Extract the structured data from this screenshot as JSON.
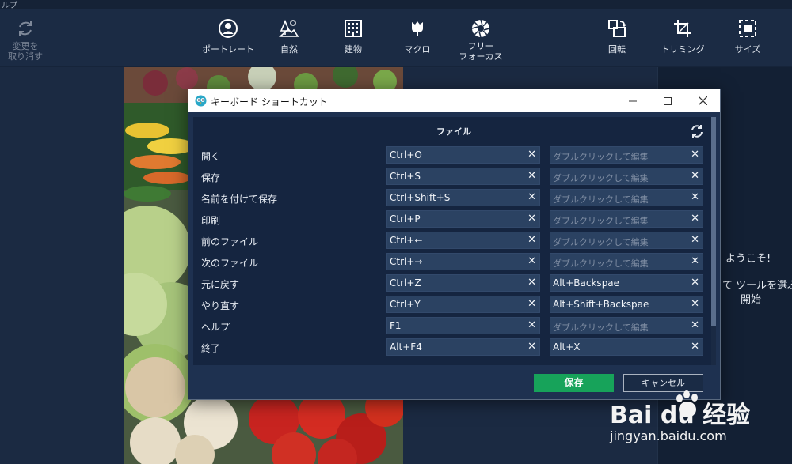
{
  "menu": {
    "partial_label": "ルプ"
  },
  "toolbar": {
    "undo": {
      "label_line1": "変更を",
      "label_line2": "取り消す",
      "icon": "undo-icon"
    },
    "tools": [
      {
        "id": "portrait",
        "label": "ポートレート",
        "icon": "portrait-icon"
      },
      {
        "id": "nature",
        "label": "自然",
        "icon": "nature-icon"
      },
      {
        "id": "building",
        "label": "建物",
        "icon": "building-icon"
      },
      {
        "id": "macro",
        "label": "マクロ",
        "icon": "tulip-icon"
      },
      {
        "id": "free-focus",
        "label_line1": "フリー",
        "label_line2": "フォーカス",
        "icon": "aperture-icon"
      },
      {
        "id": "rotate",
        "label": "回転",
        "icon": "rotate-icon"
      },
      {
        "id": "trimming",
        "label": "トリミング",
        "icon": "crop-icon"
      },
      {
        "id": "size",
        "label": "サイズ",
        "icon": "resize-icon"
      }
    ]
  },
  "right_panel": {
    "welcome": "ようこそ!",
    "hint_line1": "て ツールを選ぶ",
    "hint_line2": "開始"
  },
  "dialog": {
    "title": "キーボード ショートカット",
    "section": "ファイル",
    "placeholder": "ダブルクリックして編集",
    "rows": [
      {
        "label": "開く",
        "primary": "Ctrl+O",
        "secondary": ""
      },
      {
        "label": "保存",
        "primary": "Ctrl+S",
        "secondary": ""
      },
      {
        "label": "名前を付けて保存",
        "primary": "Ctrl+Shift+S",
        "secondary": ""
      },
      {
        "label": "印刷",
        "primary": "Ctrl+P",
        "secondary": ""
      },
      {
        "label": "前のファイル",
        "primary": "Ctrl+←",
        "secondary": ""
      },
      {
        "label": "次のファイル",
        "primary": "Ctrl+→",
        "secondary": ""
      },
      {
        "label": "元に戻す",
        "primary": "Ctrl+Z",
        "secondary": "Alt+Backspae"
      },
      {
        "label": "やり直す",
        "primary": "Ctrl+Y",
        "secondary": "Alt+Shift+Backspae"
      },
      {
        "label": "へルプ",
        "primary": "F1",
        "secondary": ""
      },
      {
        "label": "終了",
        "primary": "Alt+F4",
        "secondary": "Alt+X"
      }
    ],
    "save_label": "保存",
    "cancel_label": "キャンセル"
  },
  "watermark": {
    "logo_text": "Bai  du 经验",
    "url": "jingyan.baidu.com"
  },
  "colors": {
    "accent_save": "#17a35a",
    "background": "#16243a",
    "field": "#2b4262"
  }
}
